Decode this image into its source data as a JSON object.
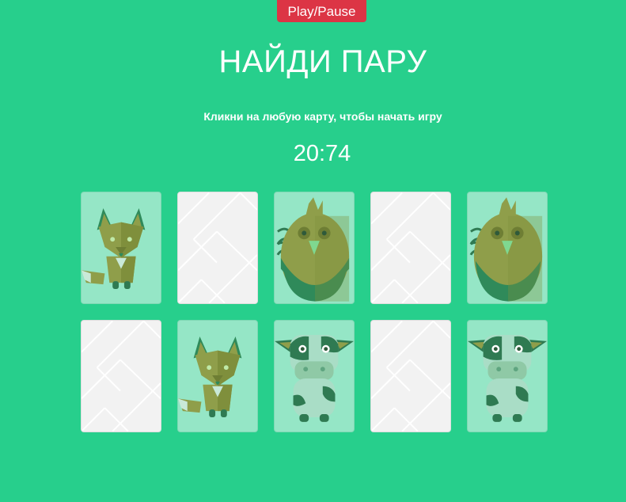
{
  "controls": {
    "play_pause_label": "Play/Pause"
  },
  "header": {
    "title": "НАЙДИ ПАРУ",
    "subtitle": "Кликни на любую карту, чтобы начать игру",
    "timer": "20:74"
  },
  "colors": {
    "background": "#27cf8c",
    "button": "#dc3545",
    "card_back": "#f2f2f2",
    "card_face": "#95e6c6"
  },
  "board": {
    "cards": [
      {
        "row": 1,
        "col": 1,
        "state": "face-up",
        "animal": "fox-icon"
      },
      {
        "row": 1,
        "col": 2,
        "state": "face-down",
        "animal": ""
      },
      {
        "row": 1,
        "col": 3,
        "state": "face-up",
        "animal": "rooster-icon"
      },
      {
        "row": 1,
        "col": 4,
        "state": "face-down",
        "animal": ""
      },
      {
        "row": 1,
        "col": 5,
        "state": "face-up",
        "animal": "rooster-icon"
      },
      {
        "row": 2,
        "col": 1,
        "state": "face-down",
        "animal": ""
      },
      {
        "row": 2,
        "col": 2,
        "state": "face-up",
        "animal": "fox-icon"
      },
      {
        "row": 2,
        "col": 3,
        "state": "face-up",
        "animal": "cow-icon"
      },
      {
        "row": 2,
        "col": 4,
        "state": "face-down",
        "animal": ""
      },
      {
        "row": 2,
        "col": 5,
        "state": "face-up",
        "animal": "cow-icon"
      }
    ]
  }
}
